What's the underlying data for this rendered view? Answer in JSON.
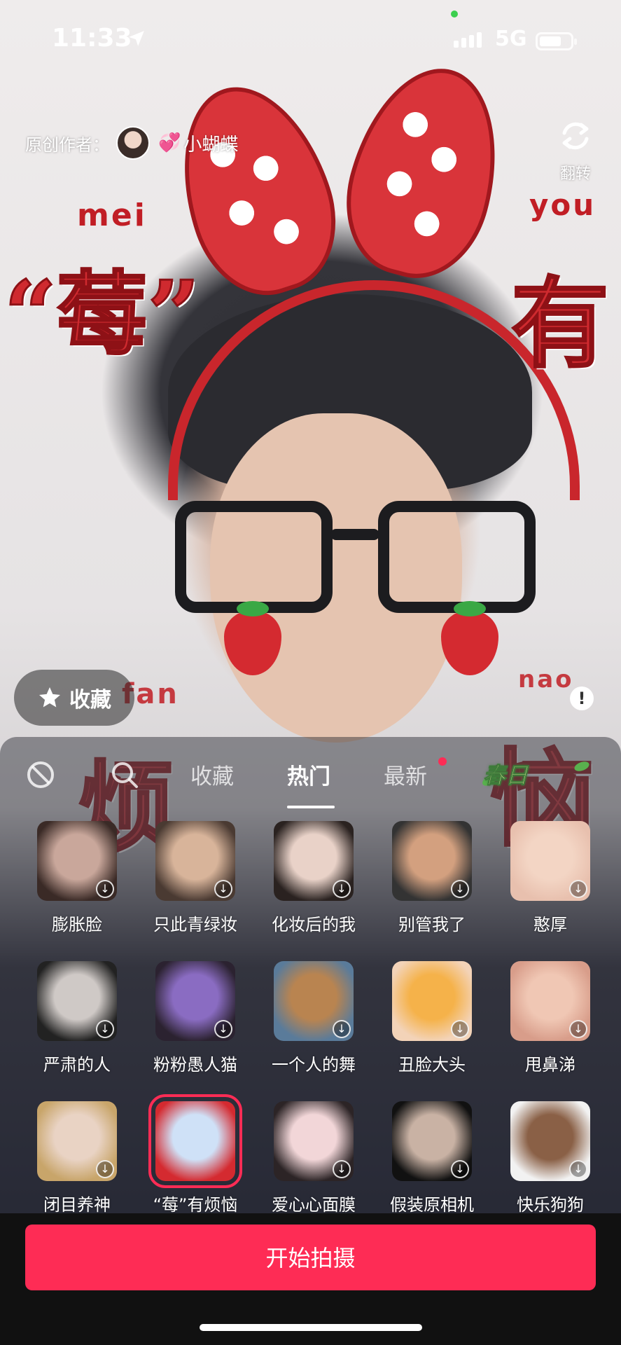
{
  "status_bar": {
    "time": "11:33",
    "network": "5G"
  },
  "header": {
    "author_label": "原创作者：",
    "author_heart_icon": "💞",
    "author_name": "小蝴蝶",
    "flip_label": "翻转"
  },
  "scene": {
    "text_mei": "mei",
    "text_you_latin": "you",
    "text_strawberry": "“莓”",
    "text_you": "有",
    "text_fan_latin": "fan",
    "text_nao_latin": "nao",
    "text_fan": "烦",
    "text_nao": "恼"
  },
  "favorite_pill": {
    "label": "收藏",
    "icon": "star-icon"
  },
  "tabs": {
    "items": [
      "收藏",
      "热门",
      "最新"
    ],
    "active": "热门",
    "spring": "春日"
  },
  "effects": [
    {
      "name": "膨胀脸",
      "colors": [
        "#c9a79b",
        "#3a2a26"
      ]
    },
    {
      "name": "只此青绿妆",
      "colors": [
        "#d8b49a",
        "#4a3a32"
      ]
    },
    {
      "name": "化妆后的我",
      "colors": [
        "#e9d2c8",
        "#2a2220"
      ]
    },
    {
      "name": "别管我了",
      "colors": [
        "#d3a07f",
        "#333"
      ]
    },
    {
      "name": "憨厚",
      "colors": [
        "#f3d5c4",
        "#e8c0ae"
      ]
    },
    {
      "name": "严肃的人",
      "colors": [
        "#cfc9c6",
        "#222"
      ]
    },
    {
      "name": "粉粉愚人猫",
      "colors": [
        "#8a6cc2",
        "#2b2230"
      ]
    },
    {
      "name": "一个人的舞",
      "colors": [
        "#b98450",
        "#5a7b9a"
      ]
    },
    {
      "name": "丑脸大头",
      "colors": [
        "#f5b24a",
        "#f3d3b8"
      ]
    },
    {
      "name": "甩鼻涕",
      "colors": [
        "#f0c7b4",
        "#d89d8a"
      ]
    },
    {
      "name": "闭目养神",
      "colors": [
        "#e9d3c4",
        "#c8a56a"
      ]
    },
    {
      "name": "“莓”有烦恼",
      "colors": [
        "#cfe1f7",
        "#d42a30"
      ]
    },
    {
      "name": "爱心心面膜",
      "colors": [
        "#f2d6d8",
        "#2c2426"
      ]
    },
    {
      "name": "假装原相机",
      "colors": [
        "#c9b2a4",
        "#111"
      ]
    },
    {
      "name": "快乐狗狗",
      "colors": [
        "#8a6046",
        "#f2f2f2"
      ]
    }
  ],
  "selected_effect": "“莓”有烦恼",
  "start_button": "开始拍摄",
  "colors": {
    "accent": "#fe2c55"
  }
}
